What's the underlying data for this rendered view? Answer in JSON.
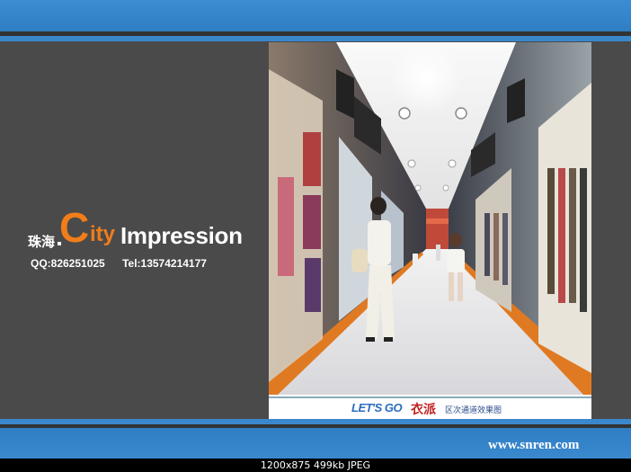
{
  "logo": {
    "zh": "珠海",
    "c": "C",
    "ity": "ity",
    "impression": "Impression"
  },
  "contact": {
    "qq": "QQ:826251025",
    "tel": "Tel:13574214177"
  },
  "render": {
    "caption_logo": "LET'S GO",
    "caption_name": "衣派",
    "caption_sub": "区次通道效果图"
  },
  "footer": {
    "site": "www.snren.com"
  },
  "image_meta": "1200x875  499kb  JPEG",
  "colors": {
    "background": "#4a4a4a",
    "band_blue": "#3a87cc",
    "accent_orange": "#f07d1a",
    "floor_orange": "#e07a22"
  }
}
